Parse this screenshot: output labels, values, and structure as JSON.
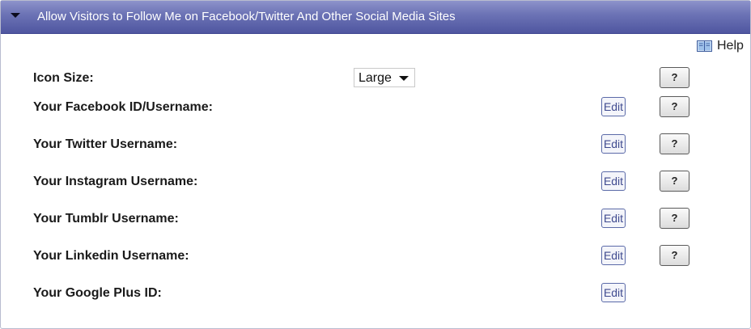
{
  "header": {
    "title": "Allow Visitors to Follow Me on Facebook/Twitter And Other Social Media Sites",
    "toggle_icon": "caret-down-icon",
    "gradient_top": "#8d93cb",
    "gradient_bottom": "#4f56a0"
  },
  "help": {
    "label": "Help",
    "icon": "book-icon"
  },
  "icon_size": {
    "label": "Icon Size:",
    "selected": "Large",
    "help_label": "?"
  },
  "rows": [
    {
      "label": "Your Facebook ID/Username:",
      "edit_label": "Edit",
      "help_label": "?"
    },
    {
      "label": "Your Twitter Username:",
      "edit_label": "Edit",
      "help_label": "?"
    },
    {
      "label": "Your Instagram Username:",
      "edit_label": "Edit",
      "help_label": "?"
    },
    {
      "label": "Your Tumblr Username:",
      "edit_label": "Edit",
      "help_label": "?"
    },
    {
      "label": "Your Linkedin Username:",
      "edit_label": "Edit",
      "help_label": "?"
    },
    {
      "label": "Your Google Plus ID:",
      "edit_label": "Edit"
    }
  ],
  "colors": {
    "edit_text": "#3f4a8f",
    "edit_border": "#5b6aa8"
  }
}
